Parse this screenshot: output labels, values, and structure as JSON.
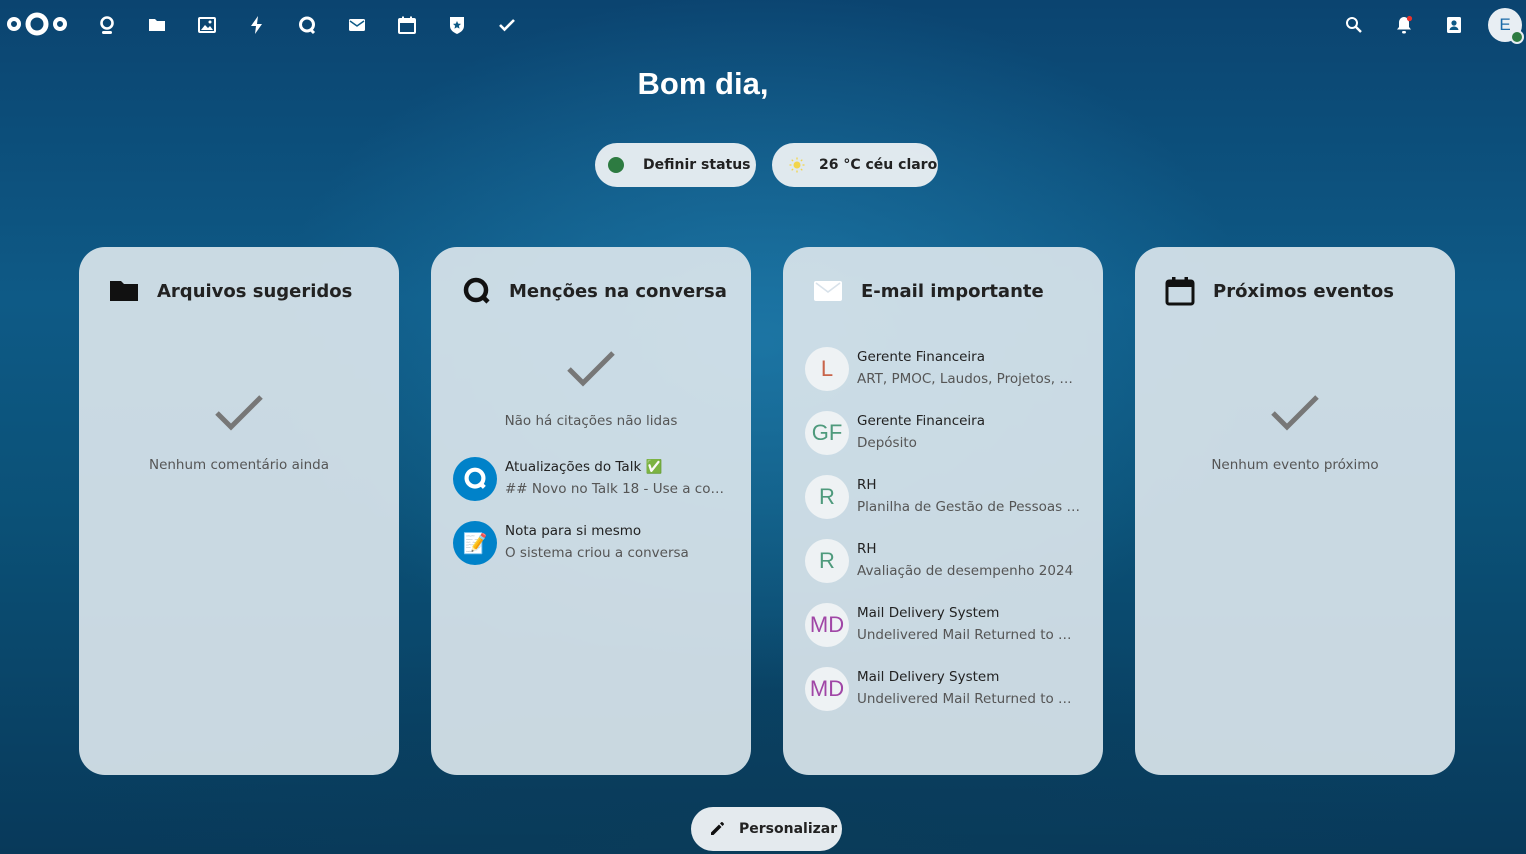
{
  "header": {
    "apps": [
      {
        "name": "dashboard-app-icon"
      },
      {
        "name": "files-app-icon"
      },
      {
        "name": "photos-app-icon"
      },
      {
        "name": "activity-app-icon"
      },
      {
        "name": "talk-app-icon"
      },
      {
        "name": "mail-app-icon"
      },
      {
        "name": "calendar-app-icon"
      },
      {
        "name": "passwords-app-icon"
      },
      {
        "name": "tasks-app-icon"
      }
    ],
    "avatar_initial": "E"
  },
  "greeting": "Bom dia,",
  "status_button": {
    "label": "Definir status",
    "color": "#2d7b41"
  },
  "weather_button": {
    "label": "26 °C céu claro"
  },
  "cards": {
    "files": {
      "title": "Arquivos sugeridos",
      "empty_text": "Nenhum comentário ainda"
    },
    "talk": {
      "title": "Menções na conversa",
      "empty_text": "Não há citações não lidas",
      "items": [
        {
          "title": "Atualizações do Talk ✅",
          "subtitle": "## Novo no Talk 18 - Use a co…"
        },
        {
          "title": "Nota para si mesmo",
          "subtitle": "O sistema criou a conversa"
        }
      ]
    },
    "mail": {
      "title": "E-mail importante",
      "items": [
        {
          "initials": "L",
          "sender": "Gerente Financeira",
          "subject": "ART, PMOC, Laudos, Projetos, …",
          "color": "#c8644a"
        },
        {
          "initials": "GF",
          "sender": "Gerente Financeira",
          "subject": "Depósito",
          "color": "#4e9a7c"
        },
        {
          "initials": "R",
          "sender": "RH",
          "subject": "Planilha de Gestão de Pessoas …",
          "color": "#4e9a7c"
        },
        {
          "initials": "R",
          "sender": "RH",
          "subject": "Avaliação de desempenho 2024",
          "color": "#4e9a7c"
        },
        {
          "initials": "MD",
          "sender": "Mail Delivery System",
          "subject": "Undelivered Mail Returned to …",
          "color": "#a046a6"
        },
        {
          "initials": "MD",
          "sender": "Mail Delivery System",
          "subject": "Undelivered Mail Returned to …",
          "color": "#a046a6"
        }
      ]
    },
    "events": {
      "title": "Próximos eventos",
      "empty_text": "Nenhum evento próximo"
    }
  },
  "customize_button": {
    "label": "Personalizar"
  }
}
